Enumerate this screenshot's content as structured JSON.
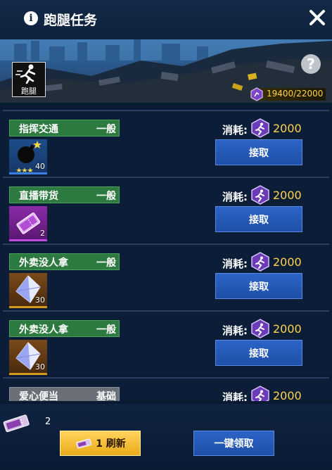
{
  "window": {
    "title": "跑腿任务"
  },
  "banner": {
    "badge_label": "跑腿",
    "stamina": "19400/22000"
  },
  "tasks": [
    {
      "name": "指挥交通",
      "grade": "一般",
      "cost_label": "消耗:",
      "cost": "2000",
      "item_qty": "40",
      "accept": "接取",
      "item_icon": "bomb-icon"
    },
    {
      "name": "直播带货",
      "grade": "一般",
      "cost_label": "消耗:",
      "cost": "2000",
      "item_qty": "2",
      "accept": "接取",
      "item_icon": "ticket-icon"
    },
    {
      "name": "外卖没人拿",
      "grade": "一般",
      "cost_label": "消耗:",
      "cost": "2000",
      "item_qty": "30",
      "accept": "接取",
      "item_icon": "crystal-icon"
    },
    {
      "name": "外卖没人拿",
      "grade": "一般",
      "cost_label": "消耗:",
      "cost": "2000",
      "item_qty": "30",
      "accept": "接取",
      "item_icon": "crystal-icon"
    },
    {
      "name": "爱心便当",
      "grade": "基础",
      "cost_label": "消耗:",
      "cost": "2000",
      "item_qty": "",
      "accept": "",
      "item_icon": ""
    }
  ],
  "footer": {
    "ticket_count": "2",
    "refresh_label": "1 刷新",
    "claim_all_label": "一键领取"
  },
  "colors": {
    "accent_gold": "#ffd34a",
    "tag_green": "#2c7a3f",
    "tag_gray": "#6a6f78",
    "button_blue": "#1e4fa8"
  }
}
